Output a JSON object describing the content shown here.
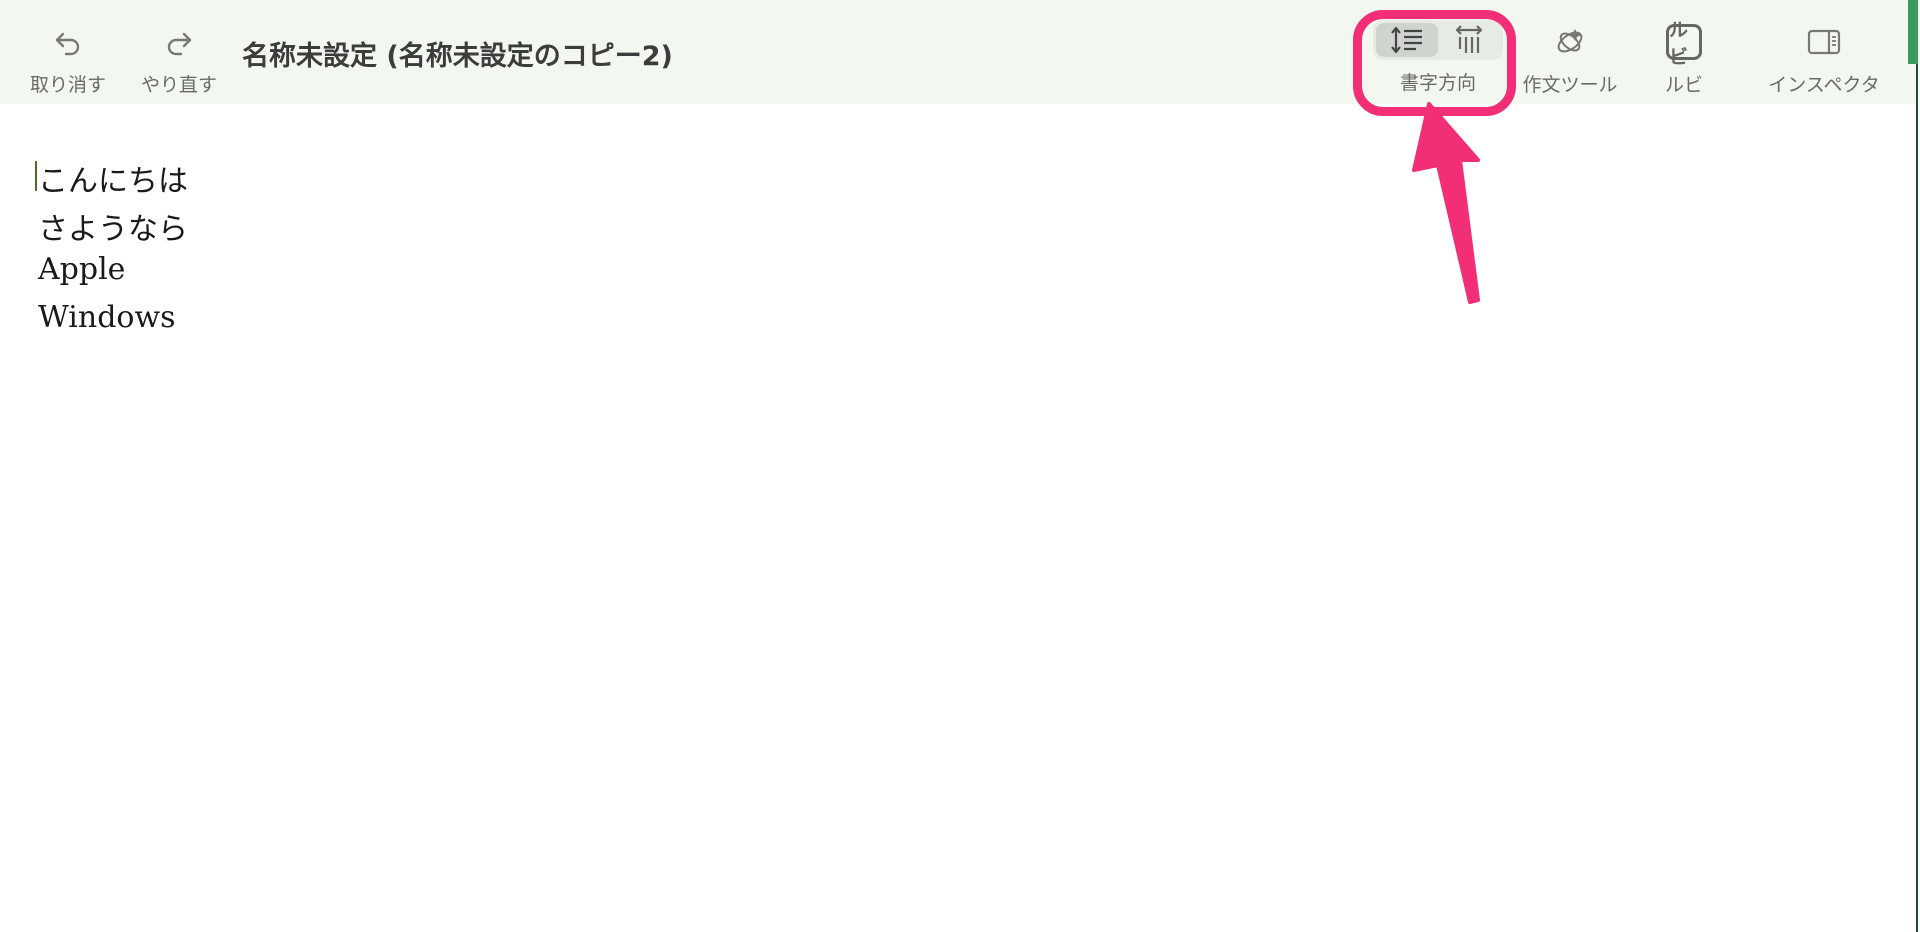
{
  "toolbar": {
    "undo_label": "取り消す",
    "redo_label": "やり直す",
    "document_title": "名称未設定 (名称未設定のコピー2)",
    "writing_direction_label": "書字方向",
    "writing_tools_label": "作文ツール",
    "ruby_label": "ルビ",
    "ruby_icon_text": "ルビ",
    "inspector_label": "インスペクタ",
    "writing_direction_selected": "horizontal"
  },
  "icons": {
    "undo": "undo-arrow-icon",
    "redo": "redo-arrow-icon",
    "horizontal": "horizontal-text-icon",
    "vertical": "vertical-text-icon",
    "writing_tools": "writing-tools-icon",
    "ruby": "ruby-icon",
    "inspector": "sidebar-icon"
  },
  "document": {
    "lines": [
      "こんにちは",
      "さようなら",
      "Apple",
      "Windows"
    ]
  },
  "colors": {
    "toolbar_bg": "#f2f7f0",
    "annotation": "#f22e77",
    "caret": "#4a6b2a"
  }
}
